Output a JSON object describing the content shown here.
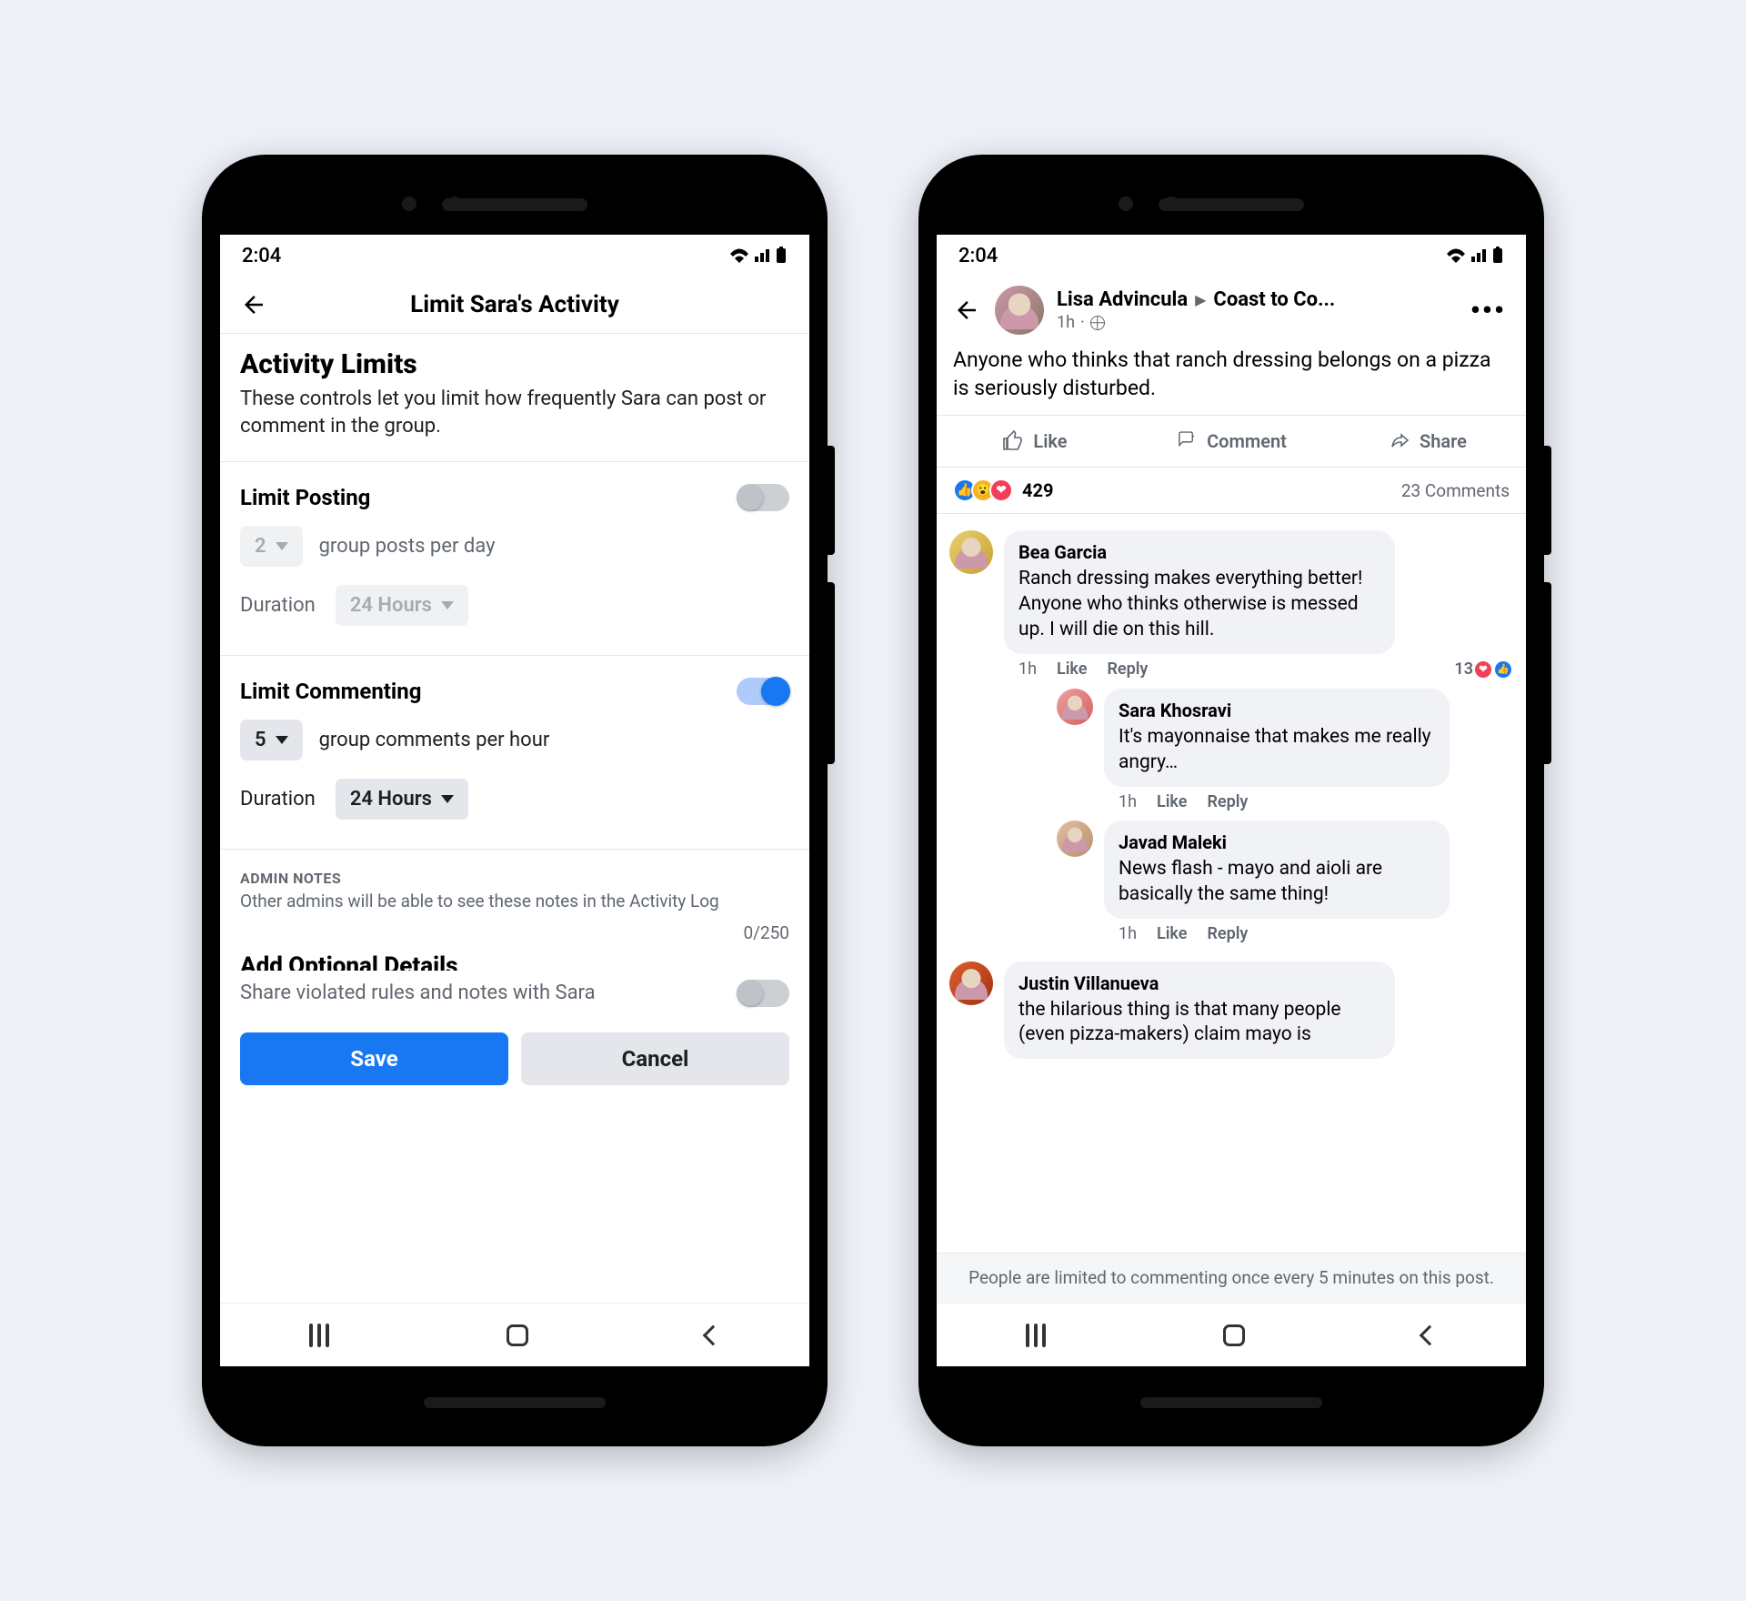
{
  "status": {
    "time": "2:04"
  },
  "phone1": {
    "header_title": "Limit Sara's Activity",
    "section_title": "Activity Limits",
    "section_desc": "These controls let you limit how frequently Sara can post or comment in the group.",
    "limit_posting": {
      "label": "Limit Posting",
      "value": "2",
      "unit": "group posts per day",
      "duration_label": "Duration",
      "duration_value": "24 Hours"
    },
    "limit_commenting": {
      "label": "Limit Commenting",
      "value": "5",
      "unit": "group comments per hour",
      "duration_label": "Duration",
      "duration_value": "24 Hours"
    },
    "admin_notes": {
      "title": "ADMIN NOTES",
      "desc": "Other admins will be able to see these notes in the Activity Log",
      "counter": "0/250"
    },
    "cutoff_heading": "Add Optional Details",
    "share_text": "Share violated rules and notes with Sara",
    "save_label": "Save",
    "cancel_label": "Cancel"
  },
  "phone2": {
    "author": "Lisa Advincula",
    "group": "Coast to Co...",
    "time": "1h",
    "post_text": "Anyone who thinks that ranch dressing belongs on a pizza is seriously disturbed.",
    "actions": {
      "like": "Like",
      "comment": "Comment",
      "share": "Share"
    },
    "react_count": "429",
    "comments_count": "23 Comments",
    "comments": [
      {
        "name": "Bea Garcia",
        "text": "Ranch dressing makes everything better! Anyone who thinks otherwise is messed up. I will die on this hill.",
        "time": "1h",
        "like": "Like",
        "reply": "Reply",
        "react_n": "13"
      },
      {
        "name": "Sara Khosravi",
        "text": "It's mayonnaise that makes me really angry…",
        "time": "1h",
        "like": "Like",
        "reply": "Reply"
      },
      {
        "name": "Javad Maleki",
        "text": "News flash - mayo and aioli are basically the same thing!",
        "time": "1h",
        "like": "Like",
        "reply": "Reply"
      },
      {
        "name": "Justin Villanueva",
        "text": "the hilarious thing is that many people (even pizza-makers) claim mayo is",
        "time": "",
        "like": "",
        "reply": ""
      }
    ],
    "limit_banner": "People are limited to commenting once every 5 minutes on this post."
  }
}
